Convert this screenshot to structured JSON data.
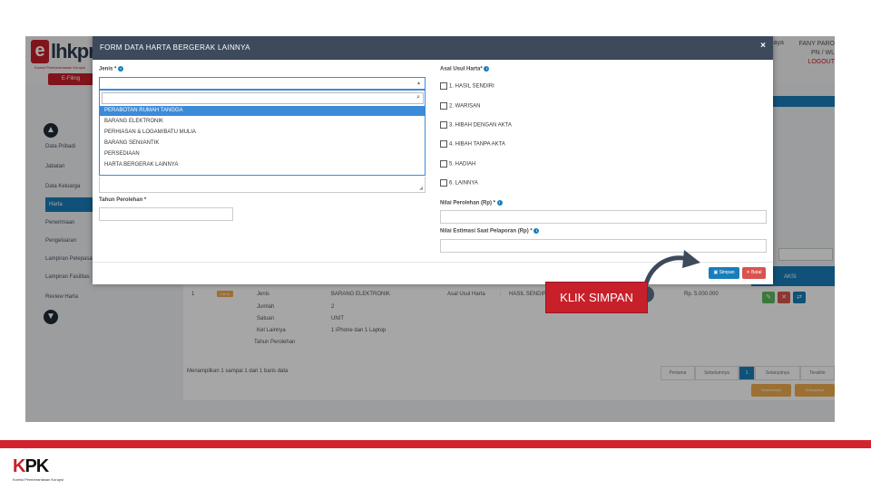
{
  "app": {
    "logo_letter": "e",
    "logo_text": "lhkpn",
    "logo_sub": "Komisi Pemberantasan Korupsi",
    "efiling": "E-Filing",
    "greeting": "Saya",
    "user_name": "FANY PARO",
    "user_role": "PN / WL",
    "logout": "LOGOUT"
  },
  "sidebar": {
    "items": [
      {
        "label": "Data Pribadi"
      },
      {
        "label": "Jabatan"
      },
      {
        "label": "Data Keluarga"
      },
      {
        "label": "Harta"
      },
      {
        "label": "Penerimaan"
      },
      {
        "label": "Pengeluaran"
      },
      {
        "label": "Lampiran Pelepasan"
      },
      {
        "label": "Lampiran Fasilitas"
      },
      {
        "label": "Review Harta"
      }
    ]
  },
  "background_table": {
    "aksi": "AKSI",
    "row_no": "1",
    "badge": "Lama",
    "labels": [
      "Jenis",
      "Jumlah",
      "Satuan",
      "Ket Lainnya",
      "Tahun Perolehan"
    ],
    "values": [
      "BARANG ELEKTRONIK",
      "2",
      "UNIT",
      "1 iPhone dan 1 Laptop"
    ],
    "asal_label": "Asal Usul Harta",
    "asal_sep": ":",
    "asal_value": "HASIL SENDIRI",
    "nilai": "Rp. 5.000.000",
    "footer_info": "Menampilkan 1 sampai 1 dari 1 baris data",
    "pager": [
      "Pertama",
      "Sebelumnya",
      "1",
      "Selanjutnya",
      "Terakhir"
    ],
    "nav_prev": "Sebelumnya",
    "nav_next": "Selanjutnya"
  },
  "modal": {
    "title": "FORM DATA HARTA BERGERAK LAINNYA",
    "close": "×",
    "jenis_label": "Jenis *",
    "dropdown_items": [
      "PERABOTAN RUMAH TANGGA",
      "BARANG ELEKTRONIK",
      "PERHIASAN & LOGAM/BATU MULIA",
      "BARANG SENI/ANTIK",
      "PERSEDIAAN",
      "HARTA BERGERAK LAINNYA"
    ],
    "tahun_label": "Tahun Perolehan *",
    "asal_label": "Asal Usul Harta*",
    "asal_options": [
      "1. HASIL SENDIRI",
      "2. WARISAN",
      "3. HIBAH DENGAN AKTA",
      "4. HIBAH TANPA AKTA",
      "5. HADIAH",
      "6. LAINNYA"
    ],
    "nilai_perolehan_label": "Nilai Perolehan (Rp) *",
    "nilai_estimasi_label": "Nilai Estimasi Saat Pelaporan (Rp) *",
    "save": "Simpan",
    "cancel": "Batal"
  },
  "callout": {
    "text": "KLIK SIMPAN"
  },
  "footer": {
    "kpk_k": "K",
    "kpk_p": "P",
    "kpk_k2": "K",
    "kpk_sub": "Komisi Pemberantasan Korupsi"
  },
  "colors": {
    "brand_red": "#c7202a",
    "primary_blue": "#1a7dbb",
    "modal_header": "#3c4a5c"
  }
}
